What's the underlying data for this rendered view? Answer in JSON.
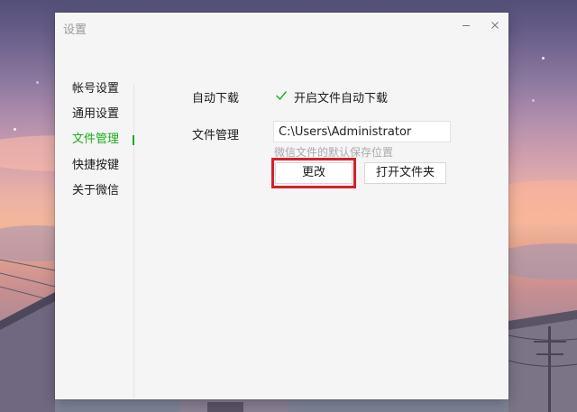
{
  "window": {
    "title": "设置",
    "minimize_icon": "minimize-icon",
    "close_icon": "close-icon"
  },
  "sidebar": {
    "items": [
      {
        "label": "帐号设置",
        "active": false
      },
      {
        "label": "通用设置",
        "active": false
      },
      {
        "label": "文件管理",
        "active": true
      },
      {
        "label": "快捷按键",
        "active": false
      },
      {
        "label": "关于微信",
        "active": false
      }
    ]
  },
  "file_management": {
    "auto_download": {
      "label": "自动下载",
      "option_label": "开启文件自动下载",
      "checked": true
    },
    "storage": {
      "label": "文件管理",
      "path_value": "C:\\Users\\Administrator",
      "hint": "微信文件的默认保存位置",
      "change_label": "更改",
      "open_folder_label": "打开文件夹"
    }
  },
  "colors": {
    "accent": "#1aad19",
    "highlight": "#d4202c",
    "window_bg": "#f5f5f5"
  }
}
